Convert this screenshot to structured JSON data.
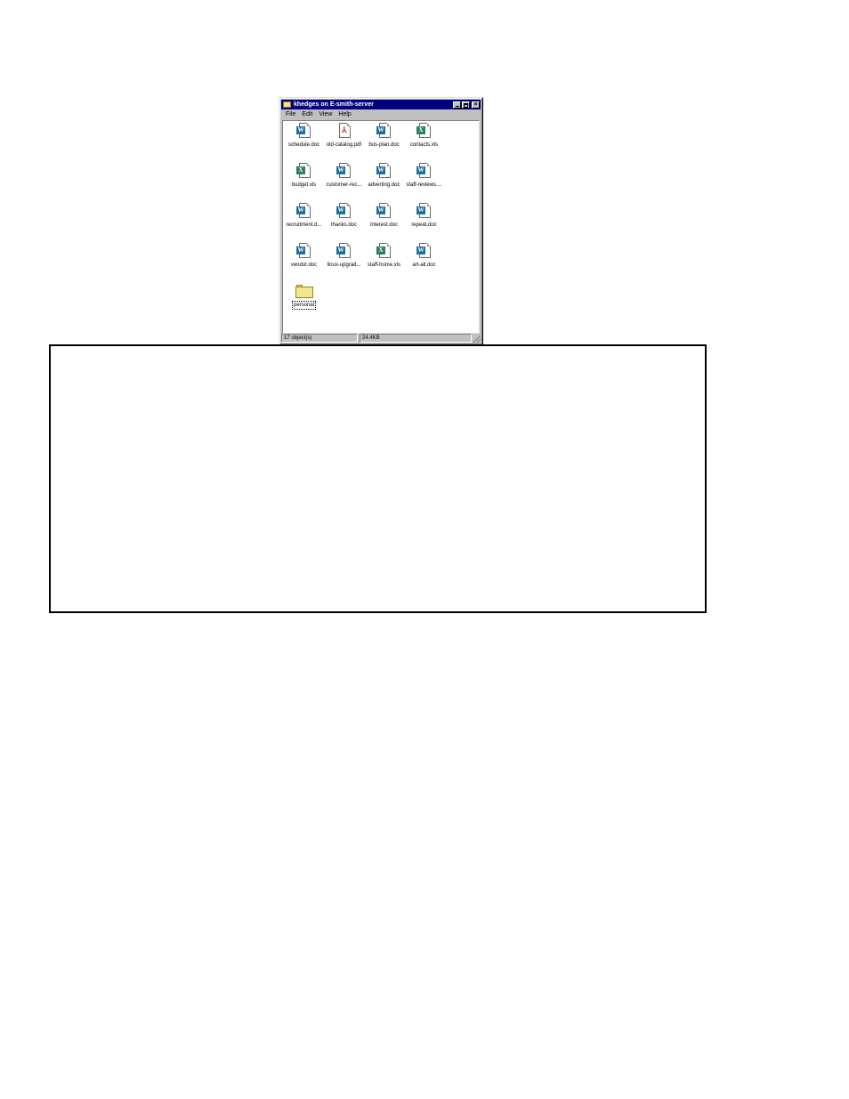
{
  "window": {
    "title": "khedges on E-smith-server",
    "icon": "folder-icon",
    "title_buttons": {
      "minimize": "minimize-icon",
      "maximize": "maximize-icon",
      "close_glyph": "×"
    }
  },
  "menu": {
    "items": [
      "File",
      "Edit",
      "View",
      "Help"
    ]
  },
  "files": [
    {
      "name": "schedule.doc",
      "type": "word"
    },
    {
      "name": "old-catalog.pdf",
      "type": "pdf"
    },
    {
      "name": "bus-plan.doc",
      "type": "word"
    },
    {
      "name": "contacts.xls",
      "type": "excel"
    },
    {
      "name": "budget.xls",
      "type": "excel"
    },
    {
      "name": "customer-rec...",
      "type": "word"
    },
    {
      "name": "adverting.doc",
      "type": "word"
    },
    {
      "name": "staff-reviews....",
      "type": "word"
    },
    {
      "name": "recruitment.d...",
      "type": "word"
    },
    {
      "name": "thanks.doc",
      "type": "word"
    },
    {
      "name": "interest.doc",
      "type": "word"
    },
    {
      "name": "repeat.doc",
      "type": "word"
    },
    {
      "name": "vendor.doc",
      "type": "word"
    },
    {
      "name": "linux-upgrad...",
      "type": "word"
    },
    {
      "name": "staff-home.xls",
      "type": "excel"
    },
    {
      "name": "art-all.doc",
      "type": "word"
    },
    {
      "name": "personal",
      "type": "folder",
      "selected": true
    }
  ],
  "badges": {
    "word": "W",
    "excel": "X",
    "pdf": "⅄"
  },
  "status": {
    "objects": "17 object(s)",
    "size": "24.4KB"
  },
  "colors": {
    "title_bar": "#000080",
    "window_face": "#c0c0c0",
    "word_badge": "#1f6f9c",
    "excel_badge": "#2a7f5c",
    "pdf_mark": "#d8191c",
    "folder": "#f3e690"
  }
}
